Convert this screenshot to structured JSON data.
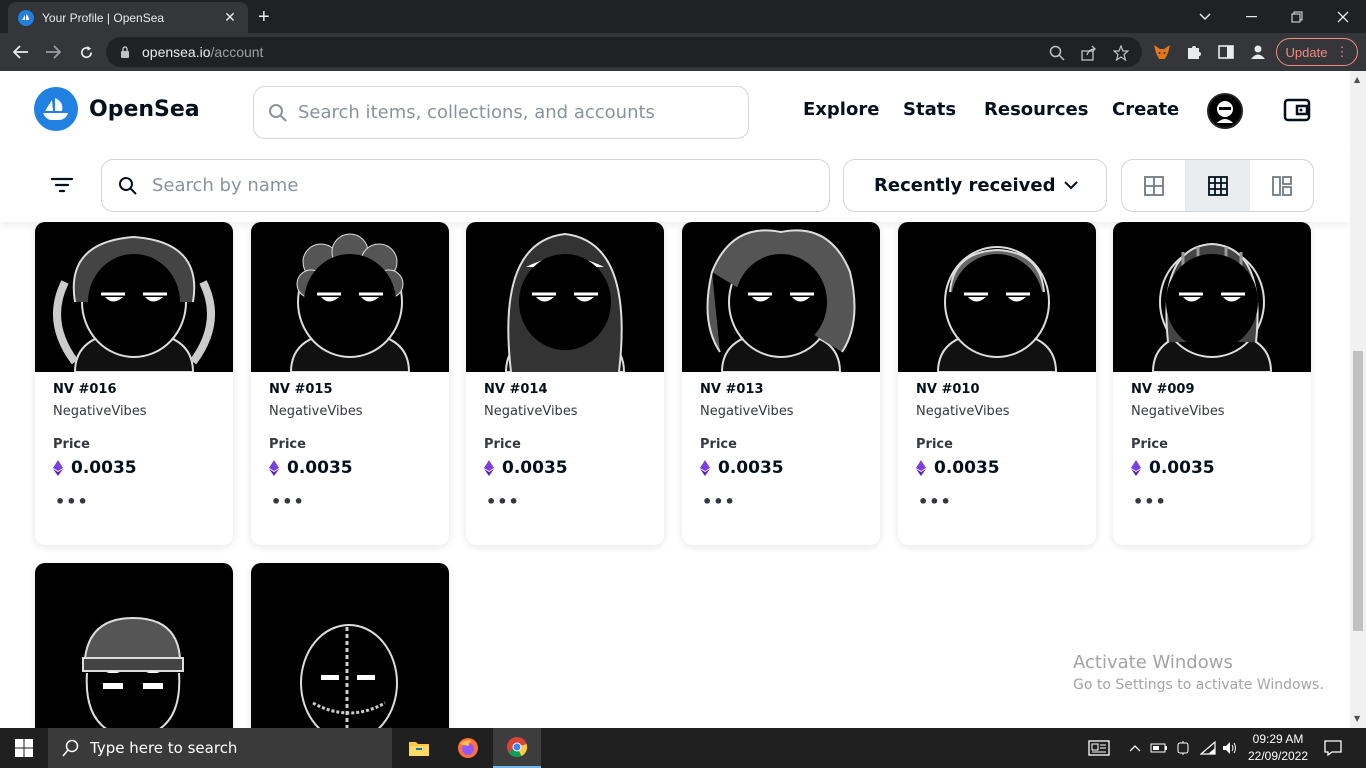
{
  "browser": {
    "tab_title": "Your Profile | OpenSea",
    "tab_close": "✕",
    "new_tab": "+",
    "url_host": "opensea.io",
    "url_path": "/account",
    "update_label": "Update",
    "window_controls": [
      "minimize",
      "restore",
      "close"
    ]
  },
  "header": {
    "logo_text": "OpenSea",
    "search_placeholder": "Search items, collections, and accounts",
    "nav": [
      "Explore",
      "Stats",
      "Resources",
      "Create"
    ]
  },
  "filterbar": {
    "search_placeholder": "Search by name",
    "sort_value": "Recently received",
    "view_modes": [
      "large-grid",
      "small-grid",
      "compact"
    ],
    "active_view": "small-grid"
  },
  "items": [
    {
      "name": "NV #016",
      "collection": "NegativeVibes",
      "price_label": "Price",
      "price": "0.0035"
    },
    {
      "name": "NV #015",
      "collection": "NegativeVibes",
      "price_label": "Price",
      "price": "0.0035"
    },
    {
      "name": "NV #014",
      "collection": "NegativeVibes",
      "price_label": "Price",
      "price": "0.0035"
    },
    {
      "name": "NV #013",
      "collection": "NegativeVibes",
      "price_label": "Price",
      "price": "0.0035"
    },
    {
      "name": "NV #010",
      "collection": "NegativeVibes",
      "price_label": "Price",
      "price": "0.0035"
    },
    {
      "name": "NV #009",
      "collection": "NegativeVibes",
      "price_label": "Price",
      "price": "0.0035"
    }
  ],
  "more_label": "•••",
  "watermark": {
    "line1": "Activate Windows",
    "line2": "Go to Settings to activate Windows."
  },
  "taskbar": {
    "search_placeholder": "Type here to search",
    "time": "09:29 AM",
    "date": "22/09/2022"
  },
  "colors": {
    "brand": "#2081e2",
    "eth": "#7b3fe4",
    "chrome_dark": "#202124",
    "taskbar": "#202020"
  }
}
